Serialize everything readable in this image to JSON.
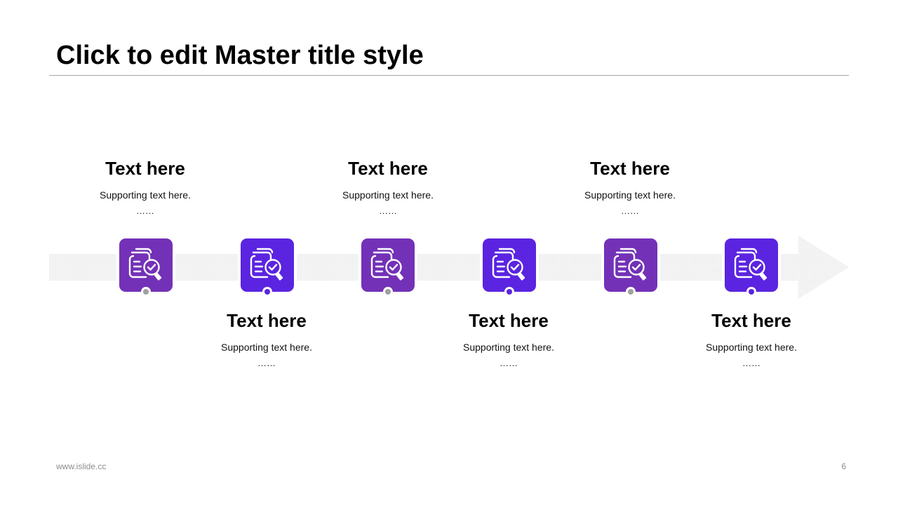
{
  "slide": {
    "title": "Click to edit Master title style",
    "footer_left": "www.islide.cc",
    "page_number": "6"
  },
  "colors": {
    "tile_violet": "#7331b7",
    "tile_blue_violet": "#5b24e0",
    "dot_gray": "#a0a0a0",
    "dot_violet": "#5b24e0",
    "arrow_fill": "#f2f2f2"
  },
  "steps": [
    {
      "heading": "Text here",
      "support": "Supporting text here.",
      "ellipsis": "……",
      "icon": "document-search-check-icon",
      "tile_color": "#7331b7",
      "dot_color": "#a0a0a0",
      "label_position": "above"
    },
    {
      "heading": "Text here",
      "support": "Supporting text here.",
      "ellipsis": "……",
      "icon": "document-search-check-icon",
      "tile_color": "#5b24e0",
      "dot_color": "#5b24e0",
      "label_position": "below"
    },
    {
      "heading": "Text here",
      "support": "Supporting text here.",
      "ellipsis": "……",
      "icon": "document-search-check-icon",
      "tile_color": "#7331b7",
      "dot_color": "#a0a0a0",
      "label_position": "above"
    },
    {
      "heading": "Text here",
      "support": "Supporting text here.",
      "ellipsis": "……",
      "icon": "document-search-check-icon",
      "tile_color": "#5b24e0",
      "dot_color": "#5b24e0",
      "label_position": "below"
    },
    {
      "heading": "Text here",
      "support": "Supporting text here.",
      "ellipsis": "……",
      "icon": "document-search-check-icon",
      "tile_color": "#7331b7",
      "dot_color": "#a0a0a0",
      "label_position": "above"
    },
    {
      "heading": "Text here",
      "support": "Supporting text here.",
      "ellipsis": "……",
      "icon": "document-search-check-icon",
      "tile_color": "#5b24e0",
      "dot_color": "#5b24e0",
      "label_position": "below"
    }
  ]
}
